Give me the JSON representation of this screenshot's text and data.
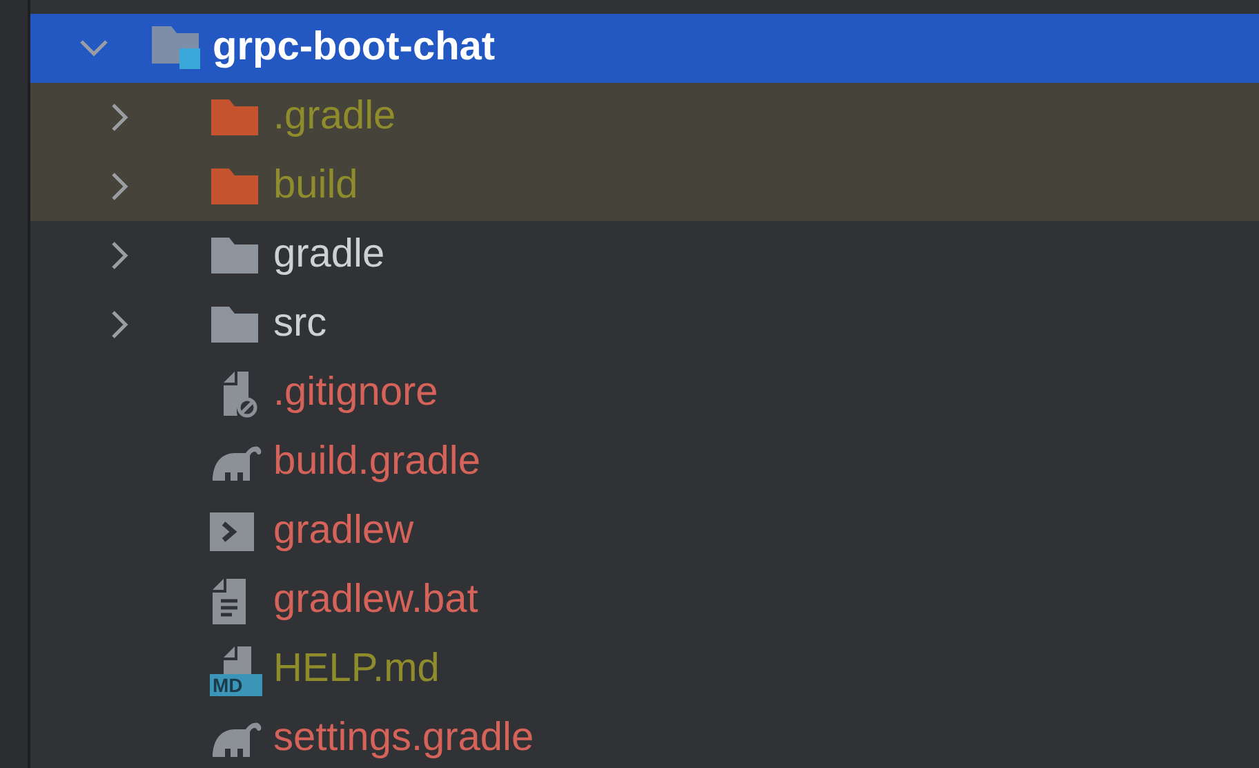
{
  "tree": [
    {
      "name": "grpc-boot-chat",
      "kind": "module",
      "expanded": true,
      "selected": true,
      "color": "#ffffff",
      "children": [
        {
          "name": ".gradle",
          "kind": "excluded-folder",
          "expanded": false,
          "selected": false,
          "color": "#8f8c2c"
        },
        {
          "name": "build",
          "kind": "excluded-folder",
          "expanded": false,
          "selected": false,
          "color": "#8f8c2c"
        },
        {
          "name": "gradle",
          "kind": "folder",
          "expanded": false,
          "selected": false,
          "color": "#cdd0d4"
        },
        {
          "name": "src",
          "kind": "folder",
          "expanded": false,
          "selected": false,
          "color": "#cdd0d4"
        },
        {
          "name": ".gitignore",
          "kind": "ignore-file",
          "selected": false,
          "color": "#d6635a"
        },
        {
          "name": "build.gradle",
          "kind": "gradle-file",
          "selected": false,
          "color": "#d6635a"
        },
        {
          "name": "gradlew",
          "kind": "shell-file",
          "selected": false,
          "color": "#d6635a"
        },
        {
          "name": "gradlew.bat",
          "kind": "text-file",
          "selected": false,
          "color": "#d6635a"
        },
        {
          "name": "HELP.md",
          "kind": "markdown-file",
          "icon_text": "MD",
          "selected": false,
          "color": "#8f8c2c"
        },
        {
          "name": "settings.gradle",
          "kind": "gradle-file",
          "selected": false,
          "color": "#d6635a"
        }
      ]
    }
  ]
}
